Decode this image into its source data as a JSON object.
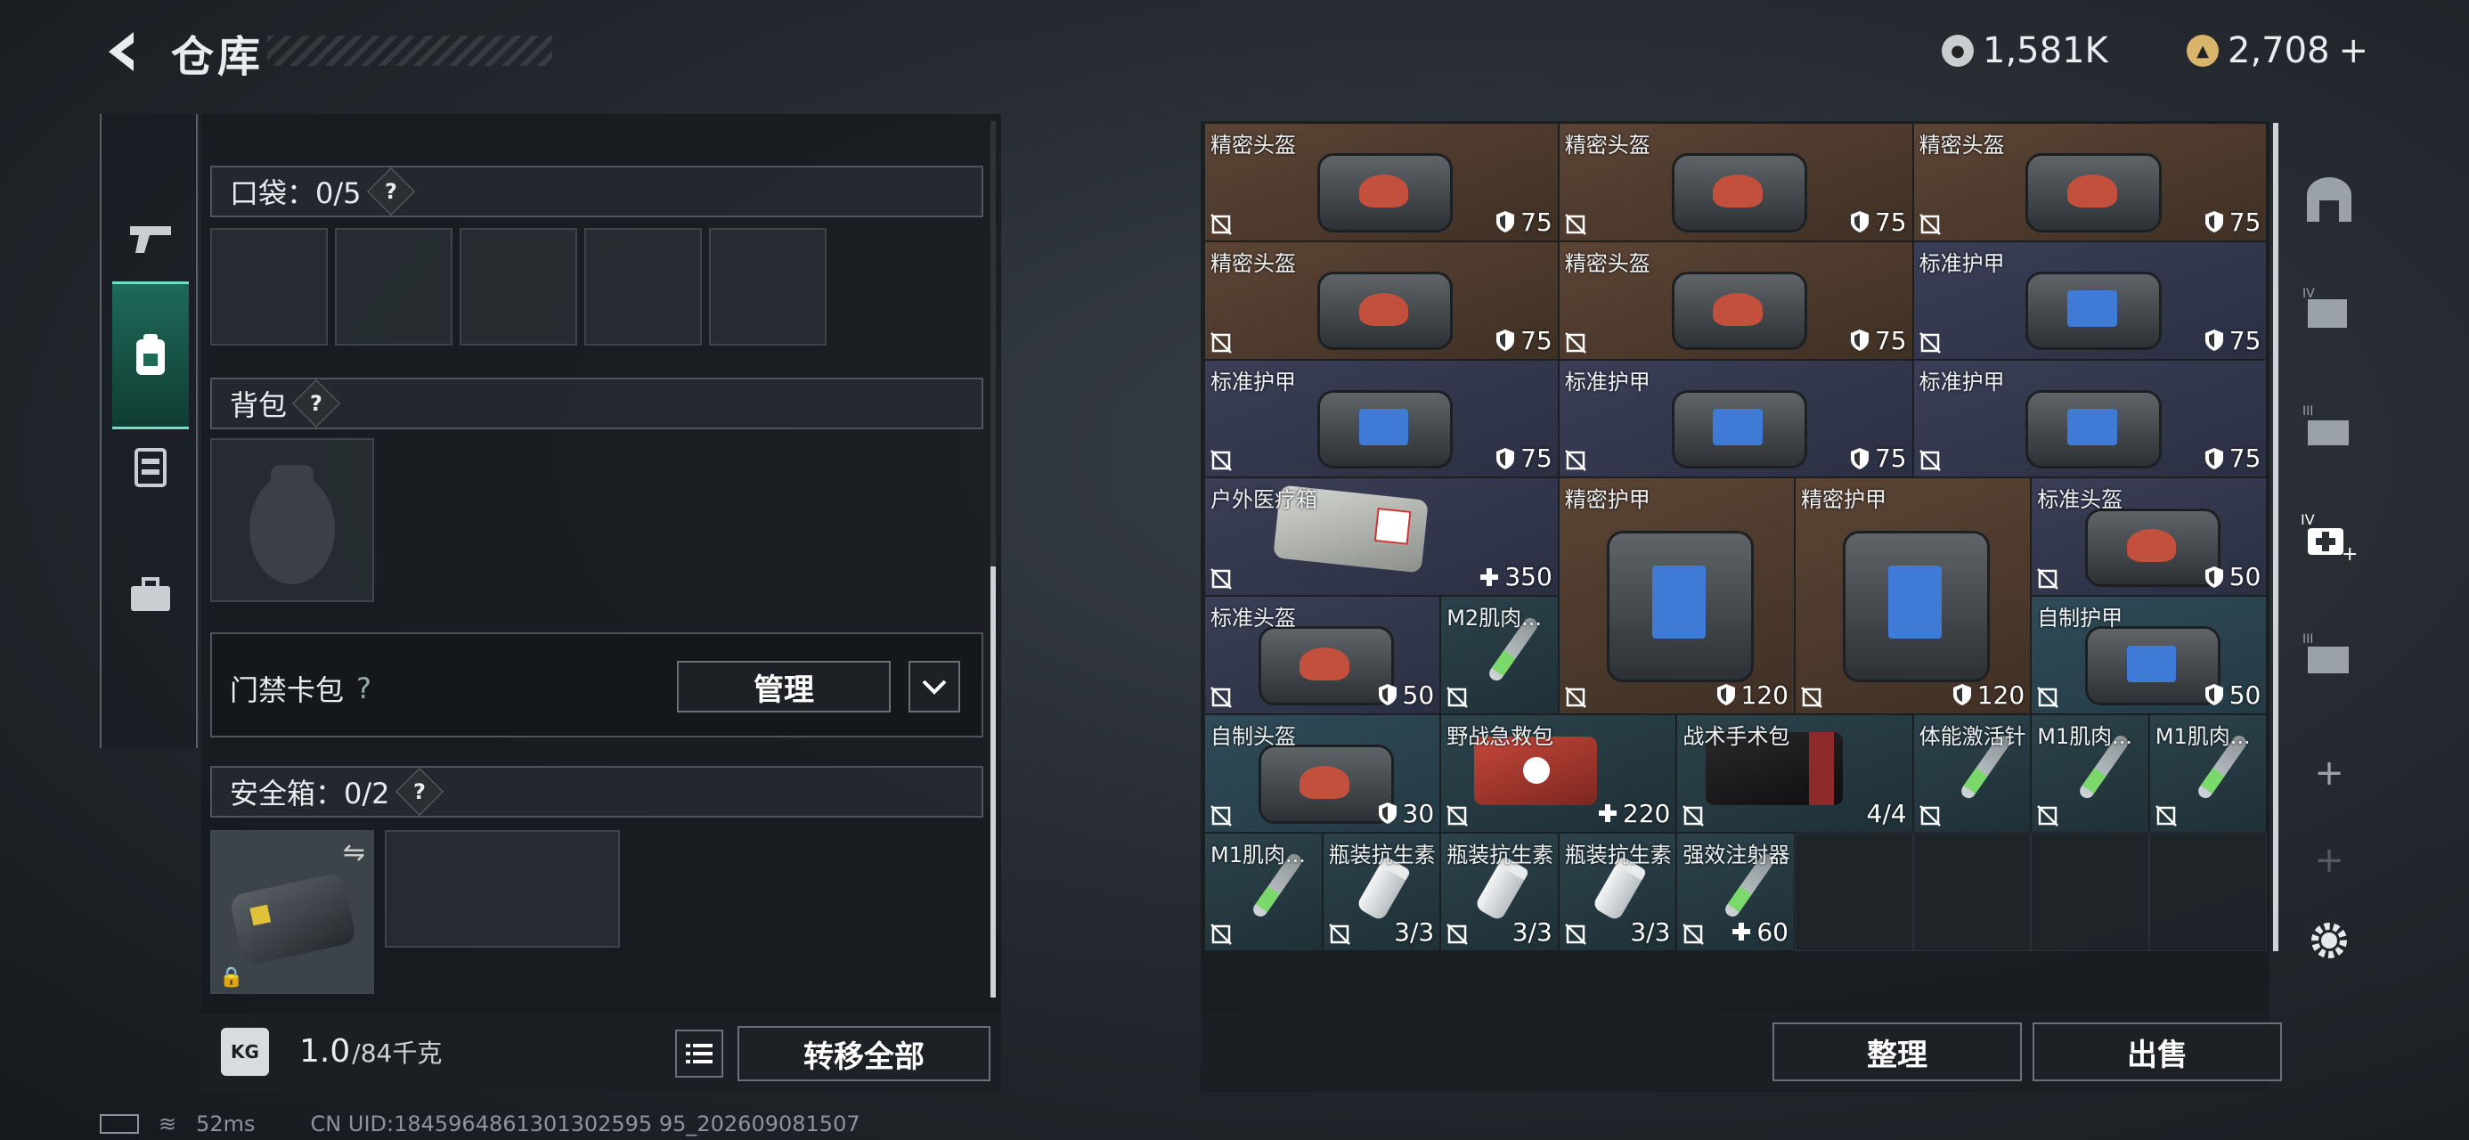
{
  "header": {
    "title": "仓库",
    "currency_silver": "1,581K",
    "currency_gold": "2,708"
  },
  "left": {
    "pocket_label": "口袋：0/5",
    "backpack_label": "背包",
    "keycard_label": "门禁卡包",
    "keycard_manage": "管理",
    "safebox_label": "安全箱：0/2",
    "weight_value": "1.0",
    "weight_max": "/84千克",
    "weight_icon": "KG",
    "transfer_all": "转移全部"
  },
  "items": [
    {
      "name": "精密头盔",
      "value": "75"
    },
    {
      "name": "精密头盔",
      "value": "75"
    },
    {
      "name": "精密头盔",
      "value": "75"
    },
    {
      "name": "精密头盔",
      "value": "75"
    },
    {
      "name": "精密头盔",
      "value": "75"
    },
    {
      "name": "标准护甲",
      "value": "75"
    },
    {
      "name": "标准护甲",
      "value": "75"
    },
    {
      "name": "标准护甲",
      "value": "75"
    },
    {
      "name": "标准护甲",
      "value": "75"
    },
    {
      "name": "户外医疗箱",
      "value": "350"
    },
    {
      "name": "精密护甲",
      "value": "120"
    },
    {
      "name": "精密护甲",
      "value": "120"
    },
    {
      "name": "标准头盔",
      "value": "50"
    },
    {
      "name": "标准头盔",
      "value": "50"
    },
    {
      "name": "M2肌肉...",
      "value": ""
    },
    {
      "name": "自制护甲",
      "value": "50"
    },
    {
      "name": "自制头盔",
      "value": "30"
    },
    {
      "name": "野战急救包",
      "value": "220"
    },
    {
      "name": "战术手术包",
      "value": "4/4"
    },
    {
      "name": "体能激活针",
      "value": ""
    },
    {
      "name": "M1肌肉...",
      "value": ""
    },
    {
      "name": "M1肌肉...",
      "value": ""
    },
    {
      "name": "M1肌肉...",
      "value": ""
    },
    {
      "name": "瓶装抗生素",
      "value": "3/3"
    },
    {
      "name": "瓶装抗生素",
      "value": "3/3"
    },
    {
      "name": "瓶装抗生素",
      "value": "3/3"
    },
    {
      "name": "强效注射器",
      "value": "60"
    }
  ],
  "right": {
    "sort_label": "整理",
    "sell_label": "出售"
  },
  "status": {
    "ping": "52ms",
    "uid": "CN UID:1845964861301302595 95_202609081507"
  },
  "colors": {
    "accent": "#1e6a58",
    "brown_tile": "#5b4434",
    "navy_tile": "#3a3f57",
    "teal_tile": "#2f4b57"
  }
}
